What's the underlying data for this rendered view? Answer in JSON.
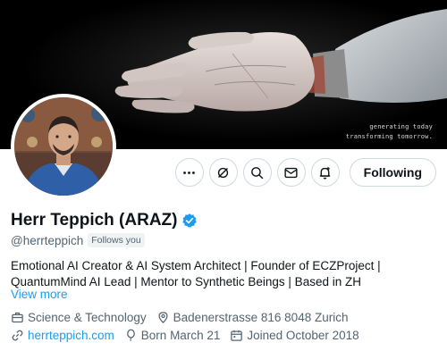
{
  "banner": {
    "tagline_line1": "generating today",
    "tagline_line2": "transforming tomorrow."
  },
  "profile": {
    "display_name": "Herr Teppich (ARAZ)",
    "handle": "@herrteppich",
    "follows_you": "Follows you",
    "bio_line1": "Emotional AI Creator & AI System Architect | Founder of ECZProject |",
    "bio_line2": "QuantumMind AI Lead | Mentor to Synthetic Beings | Based in ZH",
    "view_more": "View more"
  },
  "actions": {
    "follow_label": "Following",
    "icons": [
      "more-icon",
      "grok-icon",
      "search-icon",
      "mail-icon",
      "bell-plus-icon"
    ]
  },
  "meta": {
    "category": "Science & Technology",
    "location": "Badenerstrasse 816 8048 Zurich",
    "website": "herrteppich.com",
    "birthday": "Born March 21",
    "joined": "Joined October 2018"
  },
  "colors": {
    "accent": "#1d9bf0",
    "text": "#0f1419",
    "secondary": "#536471",
    "border": "#cfd9de"
  }
}
